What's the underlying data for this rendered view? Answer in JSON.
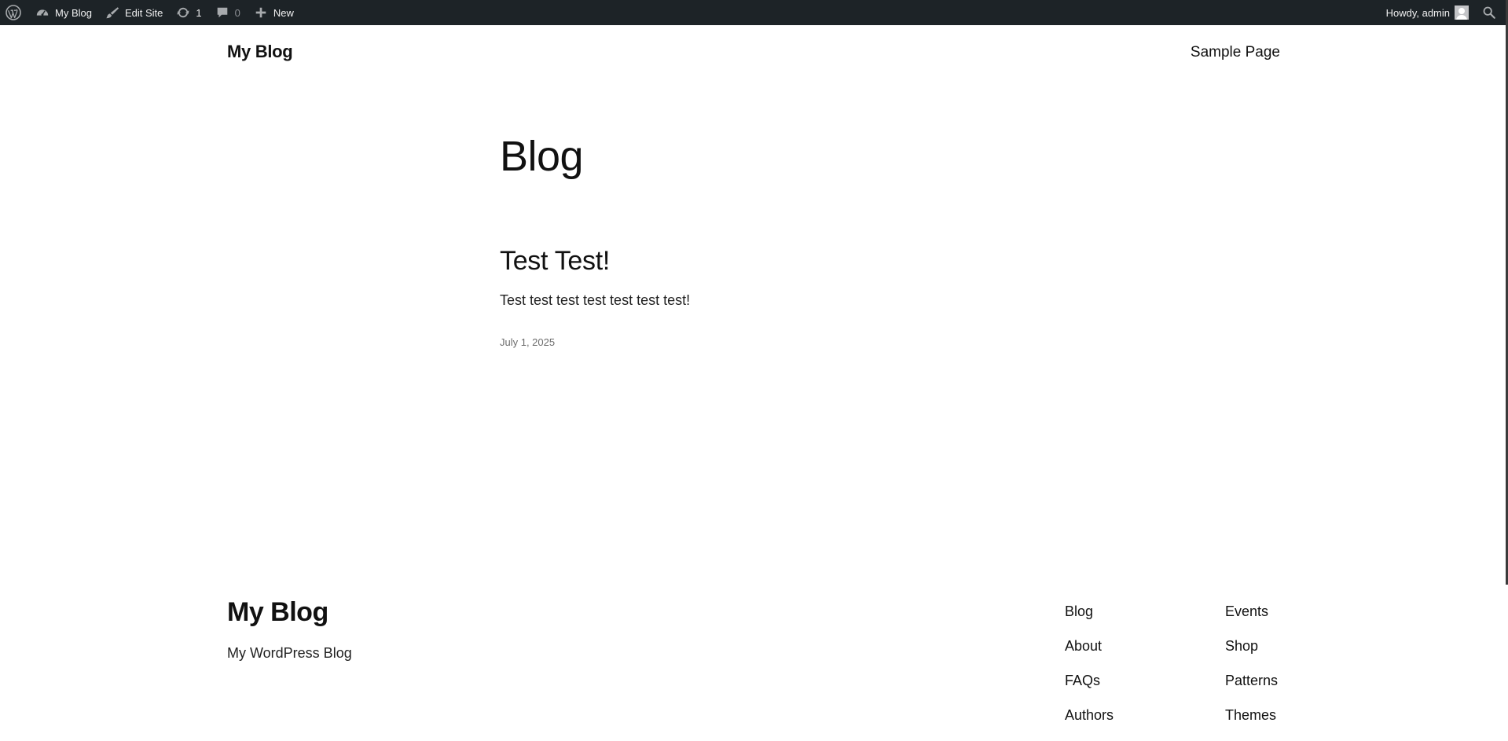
{
  "admin_bar": {
    "wp_logo_icon": "wordpress-logo-icon",
    "site_name": "My Blog",
    "site_icon": "dashboard-gauge-icon",
    "edit_site": "Edit Site",
    "edit_site_icon": "brush-icon",
    "updates_count": "1",
    "updates_icon": "update-arrows-icon",
    "comments_count": "0",
    "comments_icon": "comment-bubble-icon",
    "new_label": "New",
    "new_icon": "plus-icon",
    "howdy": "Howdy, admin",
    "avatar_icon": "user-avatar-icon",
    "search_icon": "search-icon",
    "background_color": "#1d2327"
  },
  "header": {
    "site_title": "My Blog",
    "nav": [
      {
        "label": "Sample Page"
      }
    ]
  },
  "main": {
    "page_title": "Blog",
    "posts": [
      {
        "title": "Test Test!",
        "excerpt": "Test test test test test test test!",
        "date": "July 1, 2025"
      }
    ]
  },
  "footer": {
    "site_title": "My Blog",
    "tagline": "My WordPress Blog",
    "columns": [
      {
        "links": [
          "Blog",
          "About",
          "FAQs",
          "Authors"
        ]
      },
      {
        "links": [
          "Events",
          "Shop",
          "Patterns",
          "Themes"
        ]
      }
    ]
  }
}
